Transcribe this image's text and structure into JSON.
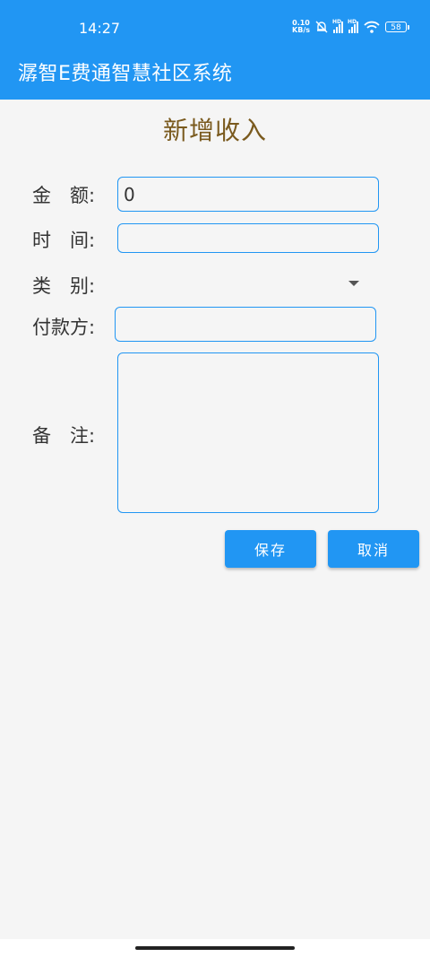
{
  "status": {
    "time": "14:27",
    "net_speed_top": "0.10",
    "net_speed_unit": "KB/s",
    "battery": "58"
  },
  "app": {
    "title": "潺智E费通智慧社区系统"
  },
  "page": {
    "title": "新增收入"
  },
  "form": {
    "amount_label": "金　额:",
    "amount_value": "0",
    "time_label": "时　间:",
    "time_value": "",
    "category_label": "类　别:",
    "category_value": "",
    "payer_label": "付款方:",
    "payer_value": "",
    "note_label": "备　注:",
    "note_value": ""
  },
  "actions": {
    "save_label": "保存",
    "cancel_label": "取消"
  },
  "colors": {
    "primary": "#2196f3",
    "title_text": "#7a5a1e",
    "background": "#f5f5f5"
  }
}
